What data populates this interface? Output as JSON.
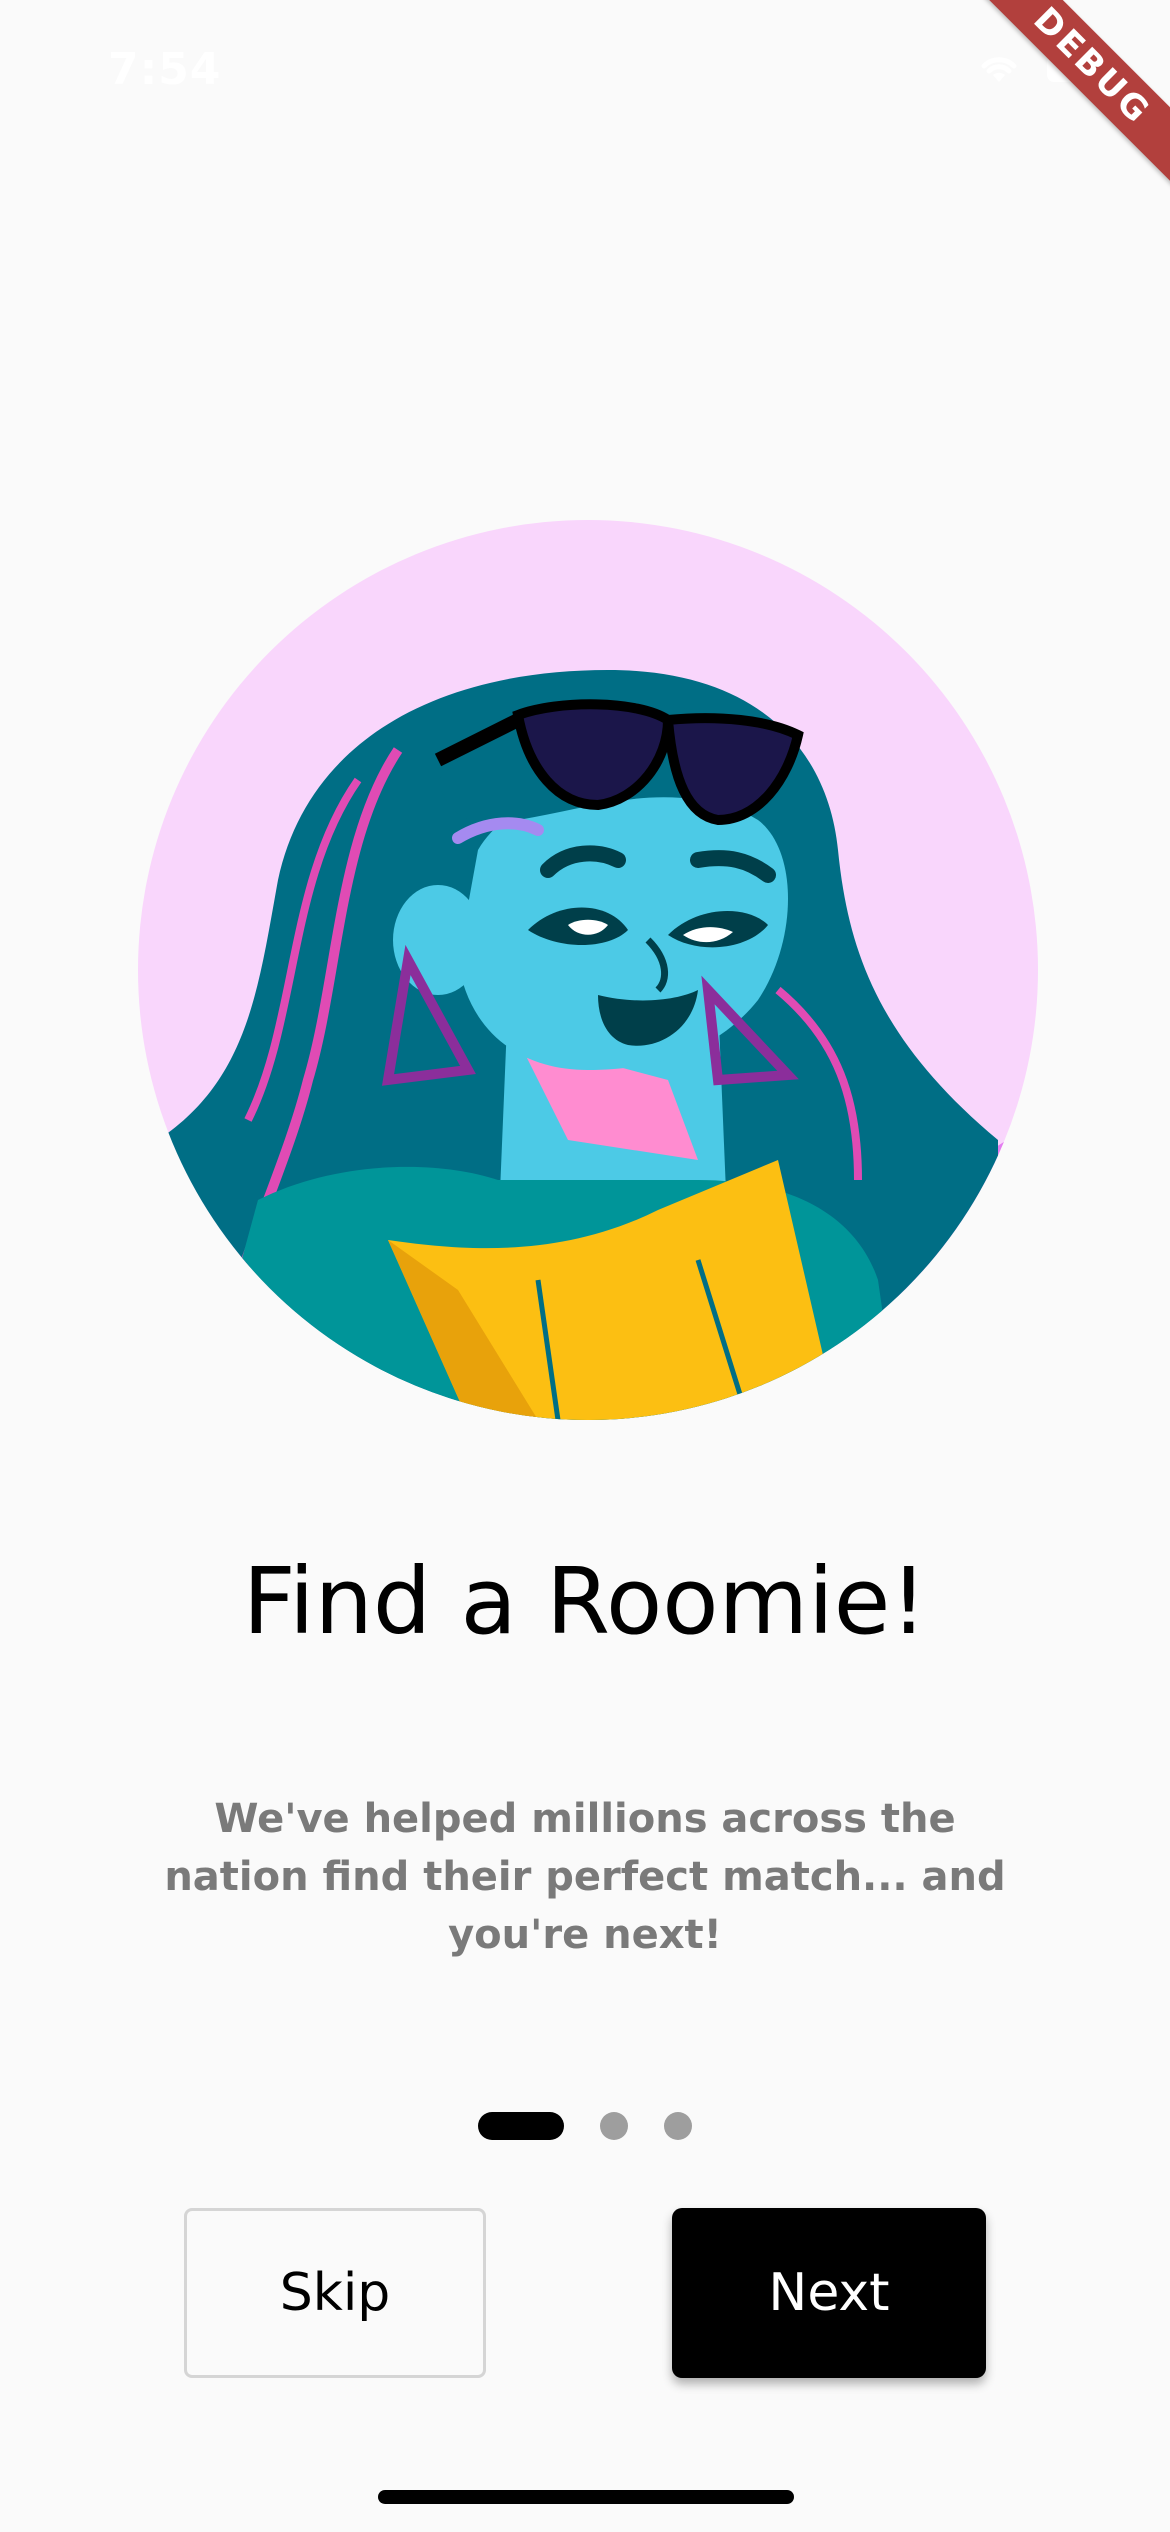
{
  "status_bar": {
    "time": "7:54"
  },
  "debug_banner": "DEBUG",
  "onboarding": {
    "title": "Find a Roomie!",
    "description": "We've helped millions across the nation find their perfect match... and you're next!",
    "page_count": 3,
    "current_page": 1
  },
  "buttons": {
    "skip": "Skip",
    "next": "Next"
  },
  "colors": {
    "background": "#fafafa",
    "illustration_bg": "#f9d6fc",
    "primary": "#000000",
    "subtitle": "#7a7a7a",
    "dot_inactive": "#9e9e9e",
    "debug_ribbon": "#b2403d"
  },
  "icons": [
    "wifi-icon",
    "battery-icon"
  ]
}
